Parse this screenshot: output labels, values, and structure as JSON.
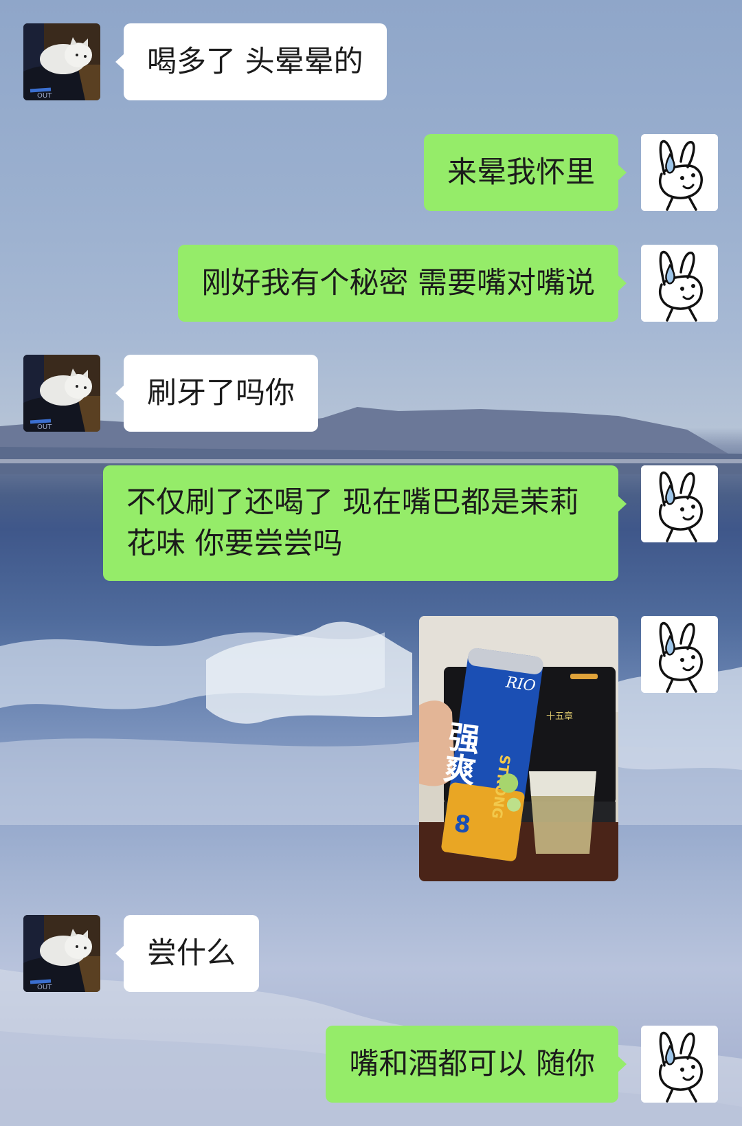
{
  "messages": [
    {
      "side": "left",
      "text": "喝多了 头晕晕的"
    },
    {
      "side": "right",
      "text": "来晕我怀里"
    },
    {
      "side": "right",
      "text": "刚好我有个秘密 需要嘴对嘴说"
    },
    {
      "side": "left",
      "text": "刷牙了吗你"
    },
    {
      "side": "right",
      "text": "不仅刷了还喝了 现在嘴巴都是茉莉花味 你要尝尝吗"
    },
    {
      "side": "right",
      "type": "image",
      "image": "beer-can-photo"
    },
    {
      "side": "left",
      "text": "尝什么"
    },
    {
      "side": "right",
      "text": "嘴和酒都可以 随你"
    }
  ],
  "photo": {
    "can_brand": "RIO",
    "can_text_main": "强爽",
    "can_text_side": "STRONG",
    "can_abv": "8",
    "screen_text": "十五章"
  },
  "colors": {
    "my_bubble": "#95ec69",
    "their_bubble": "#ffffff"
  },
  "icons": {
    "my_avatar": "bunny-drawing-icon",
    "their_avatar": "white-cat-photo"
  }
}
